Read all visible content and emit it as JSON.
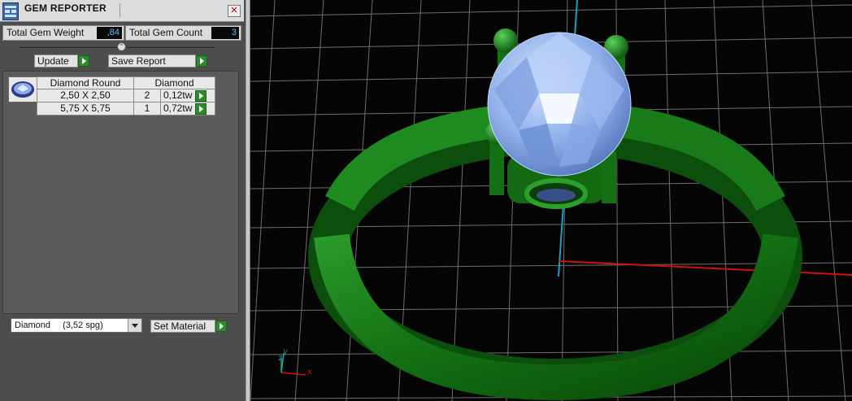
{
  "window": {
    "title": "GEM REPORTER",
    "close_symbol": "✕"
  },
  "totals": {
    "weight_label": "Total Gem Weight",
    "weight_value": ",84",
    "count_label": "Total Gem Count",
    "count_value": "3"
  },
  "actions": {
    "update_label": "Update",
    "save_report_label": "Save Report"
  },
  "gem_table": {
    "headers": [
      "Diamond Round",
      "Diamond"
    ],
    "rows": [
      {
        "size": "2,50 X 2,50",
        "count": "2",
        "weight": "0,12tw"
      },
      {
        "size": "5,75 X 5,75",
        "count": "1",
        "weight": "0,72tw"
      }
    ]
  },
  "material": {
    "selected": "Diamond",
    "density": "(3,52 spg)",
    "set_label": "Set Material"
  },
  "viewport": {
    "axis_labels": {
      "x": "x",
      "y": "y",
      "z": "z"
    },
    "colors": {
      "ring": "#1a7a1a",
      "gem": "#9ec0f5",
      "x_axis": "#d01010",
      "y_axis": "#1aa0c8",
      "grid": "#6e6e6e"
    }
  },
  "icons": {
    "window": "app-icon",
    "thumb": "gem-thumbnail-icon",
    "play": "play-arrow-icon"
  }
}
